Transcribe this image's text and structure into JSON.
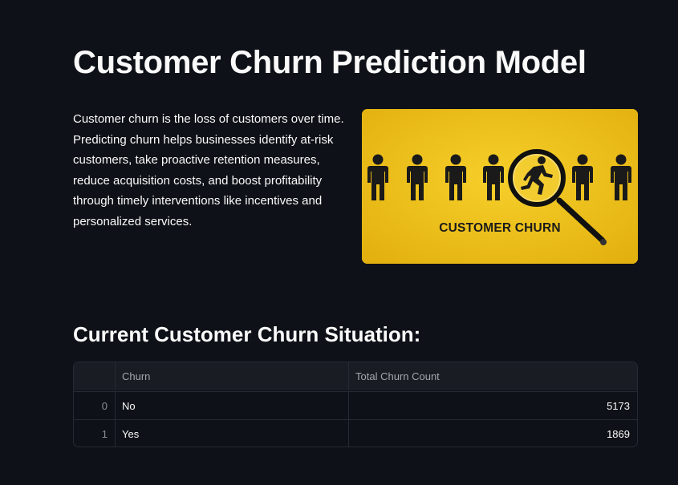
{
  "page": {
    "title": "Customer Churn Prediction Model",
    "intro": "Customer churn is the loss of customers over time. Predicting churn helps businesses identify at-risk customers, take proactive retention measures, reduce acquisition costs, and boost profitability through timely interventions like incentives and personalized services."
  },
  "hero_image": {
    "caption": "CUSTOMER CHURN",
    "background_color": "#f0c419",
    "icon_names": [
      "person-icon",
      "magnifying-glass-icon",
      "running-person-icon"
    ]
  },
  "section": {
    "title": "Current Customer Churn Situation:"
  },
  "table": {
    "columns": [
      "",
      "Churn",
      "Total Churn Count"
    ],
    "rows": [
      {
        "index": "0",
        "churn": "No",
        "count": "5173"
      },
      {
        "index": "1",
        "churn": "Yes",
        "count": "1869"
      }
    ]
  },
  "colors": {
    "background": "#0e1117",
    "text": "#fafafa",
    "table_border": "#262a33"
  }
}
